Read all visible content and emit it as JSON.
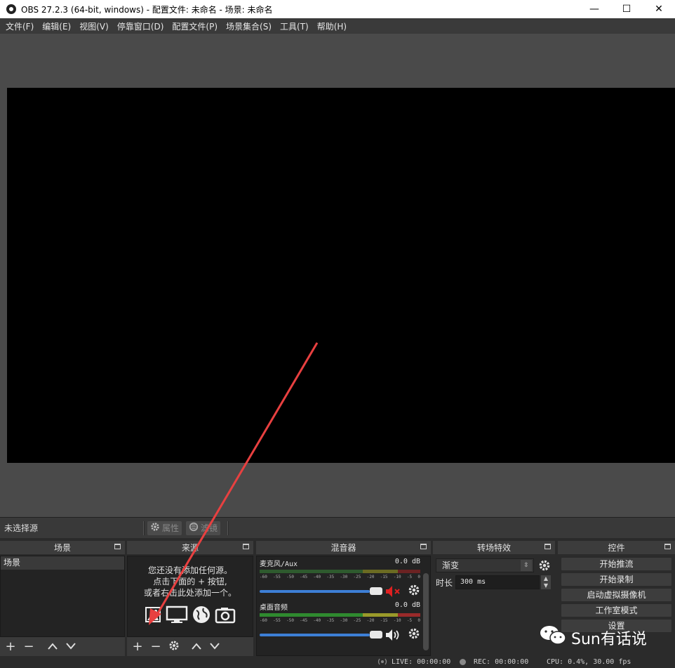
{
  "window": {
    "title": "OBS 27.2.3 (64-bit, windows) - 配置文件: 未命名 - 场景: 未命名",
    "minimize": "—",
    "maximize": "☐",
    "close": "✕"
  },
  "menu": [
    "文件(F)",
    "编辑(E)",
    "视图(V)",
    "停靠窗口(D)",
    "配置文件(P)",
    "场景集合(S)",
    "工具(T)",
    "帮助(H)"
  ],
  "source_toolbar": {
    "no_selection": "未选择源",
    "properties": "属性",
    "filters": "滤镜"
  },
  "scenes": {
    "title": "场景",
    "items": [
      "场景"
    ]
  },
  "sources": {
    "title": "来源",
    "empty_line1": "您还没有添加任何源。",
    "empty_line2": "点击下面的 + 按钮,",
    "empty_line3": "或者右击此处添加一个。"
  },
  "mixer": {
    "title": "混音器",
    "channels": [
      {
        "name": "麦克风/Aux",
        "level": "0.0 dB",
        "muted": true,
        "volume_fraction": 1.0
      },
      {
        "name": "桌面音频",
        "level": "0.0 dB",
        "muted": false,
        "volume_fraction": 1.0
      }
    ],
    "ticks": [
      "-60",
      "-55",
      "-50",
      "-45",
      "-40",
      "-35",
      "-30",
      "-25",
      "-20",
      "-15",
      "-10",
      "-5",
      "0"
    ]
  },
  "transitions": {
    "title": "转场特效",
    "selected": "渐变",
    "duration_label": "时长",
    "duration_value": "300 ms"
  },
  "controls": {
    "title": "控件",
    "buttons": [
      "开始推流",
      "开始录制",
      "启动虚拟摄像机",
      "工作室模式",
      "设置"
    ]
  },
  "status": {
    "live": "LIVE: 00:00:00",
    "rec": "REC: 00:00:00",
    "cpu": "CPU: 0.4%, 30.00 fps"
  },
  "watermark": "Sun有话说",
  "colors": {
    "accent_blue": "#3d7fd6",
    "mute_red": "#e02020",
    "annotation_arrow": "#e84040"
  }
}
